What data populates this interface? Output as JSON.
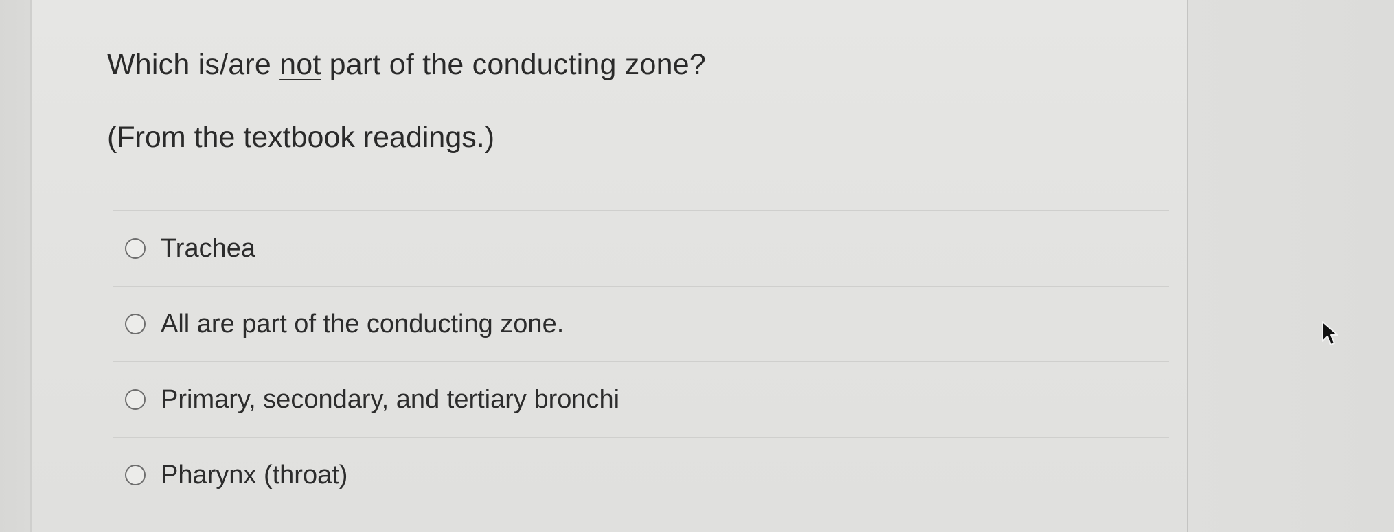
{
  "question": {
    "prefix": "Which is/are ",
    "emphasis": "not",
    "suffix": " part of the conducting zone?",
    "note": "(From the textbook readings.)"
  },
  "answers": [
    {
      "label": "Trachea",
      "selected": false
    },
    {
      "label": "All are part of the conducting zone.",
      "selected": false
    },
    {
      "label": "Primary, secondary, and tertiary bronchi",
      "selected": false
    },
    {
      "label": "Pharynx (throat)",
      "selected": false
    }
  ],
  "colors": {
    "text": "#2a2a2a",
    "background": "#e4e4e2",
    "divider": "#cfcfcd",
    "radio_border": "#6e6e6e"
  },
  "icons": {
    "radio": "radio-unchecked-icon",
    "cursor": "mouse-pointer-icon"
  }
}
